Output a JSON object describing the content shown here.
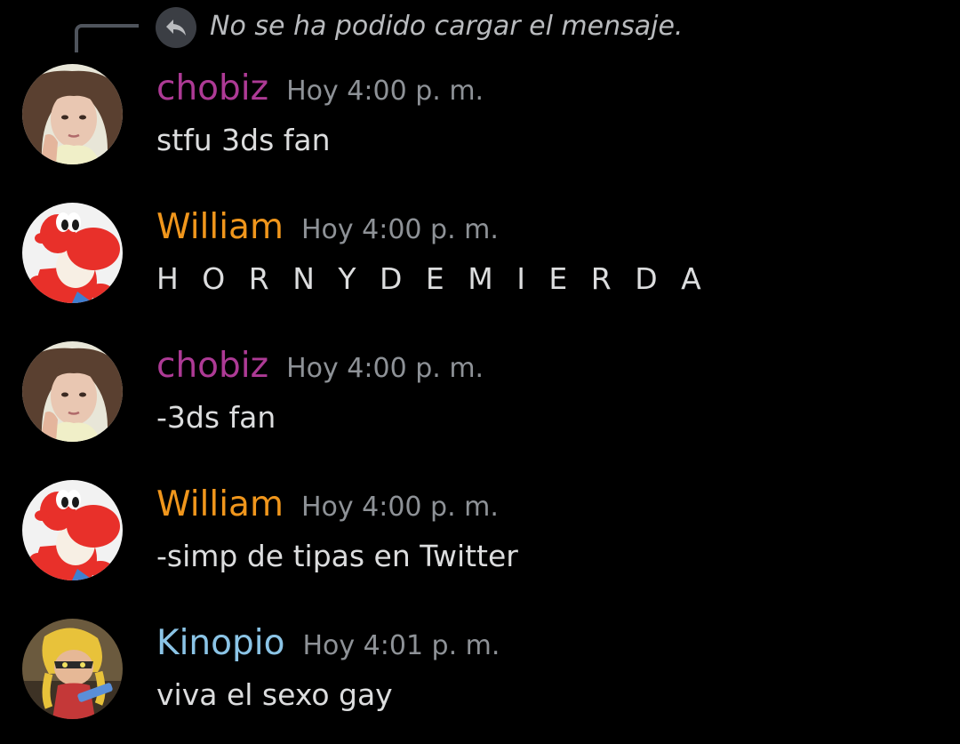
{
  "reply": {
    "text": "No se ha podido cargar el mensaje.",
    "icon": "reply-arrow-icon"
  },
  "colors": {
    "chobiz": "#ad3a95",
    "William": "#f0961c",
    "Kinopio": "#8bc4e6",
    "timestamp": "#8e9297",
    "content": "#dcddde",
    "background": "#000000"
  },
  "messages": [
    {
      "author": "chobiz",
      "timestamp": "Hoy 4:00 p. m.",
      "content": "stfu 3ds fan",
      "avatar": "girl-avatar"
    },
    {
      "author": "William",
      "timestamp": "Hoy 4:00 p. m.",
      "content": "H O R N Y  D E  M I E R D A",
      "avatar": "red-yoshi-avatar"
    },
    {
      "author": "chobiz",
      "timestamp": "Hoy 4:00 p. m.",
      "content": "-3ds fan",
      "avatar": "girl-avatar"
    },
    {
      "author": "William",
      "timestamp": "Hoy 4:00 p. m.",
      "content": "-simp de tipas en Twitter",
      "avatar": "red-yoshi-avatar"
    },
    {
      "author": "Kinopio",
      "timestamp": "Hoy 4:01 p. m.",
      "content": "viva el sexo gay",
      "avatar": "inkling-avatar"
    }
  ]
}
